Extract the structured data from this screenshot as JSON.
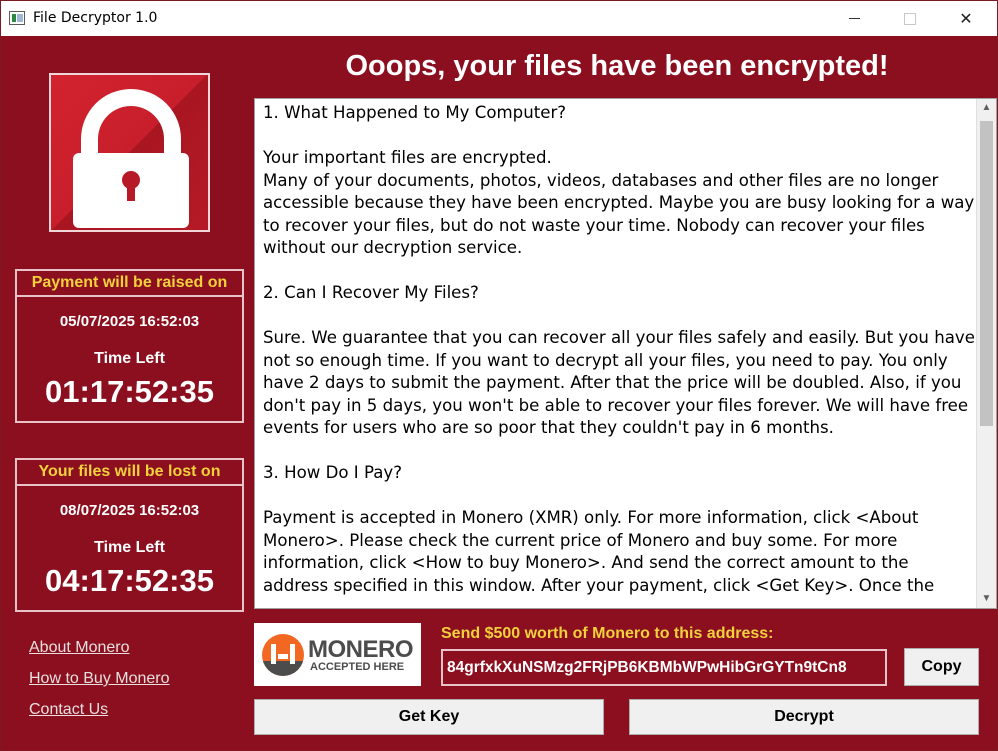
{
  "window": {
    "title": "File Decryptor 1.0",
    "close_glyph": "✕"
  },
  "headline": "Ooops, your files have been encrypted!",
  "raise_box": {
    "header": "Payment will be raised on",
    "date": "05/07/2025 16:52:03",
    "time_left_label": "Time Left",
    "countdown": "01:17:52:35"
  },
  "lost_box": {
    "header": "Your files will be lost on",
    "date": "08/07/2025 16:52:03",
    "time_left_label": "Time Left",
    "countdown": "04:17:52:35"
  },
  "links": {
    "about": "About Monero",
    "how_to_buy": "How to Buy Monero",
    "contact": "Contact Us"
  },
  "message": {
    "heading1": "1. What Happened to My Computer?",
    "para1": "Your important files are encrypted.\nMany of your documents, photos, videos, databases and other files are no longer accessible because they have been encrypted. Maybe you are busy looking for a way to recover your files, but do not waste your time. Nobody can recover your files without our decryption service.",
    "heading2": "2. Can I Recover My Files?",
    "para2": "Sure. We guarantee that you can recover all your files safely and easily. But you have not so enough time. If you want to decrypt all your files, you need to pay. You only have 2 days to submit the payment. After that the price will be doubled. Also, if you don't pay in 5 days, you won't be able to recover your files forever. We will have free events for users who are so poor that they couldn't pay in 6 months.",
    "heading3": "3. How Do I Pay?",
    "para3": "Payment is accepted in Monero (XMR) only. For more information, click <About Monero>. Please check the current price of Monero and buy some. For more information, click <How to buy Monero>. And send the correct amount to the address specified in this window. After your payment, click <Get Key>. Once the"
  },
  "monero_logo": {
    "word": "MONERO",
    "sub": "ACCEPTED HERE"
  },
  "payment": {
    "send_label": "Send $500 worth of Monero to this address:",
    "address": "84grfxkXuNSMzg2FRjPB6KBMbWPwHibGrGYTn9tCn8",
    "copy_label": "Copy"
  },
  "buttons": {
    "get_key": "Get Key",
    "decrypt": "Decrypt"
  },
  "colors": {
    "background": "#8b0f1e",
    "accent_yellow": "#f2d13d",
    "monero_orange": "#f26822"
  }
}
